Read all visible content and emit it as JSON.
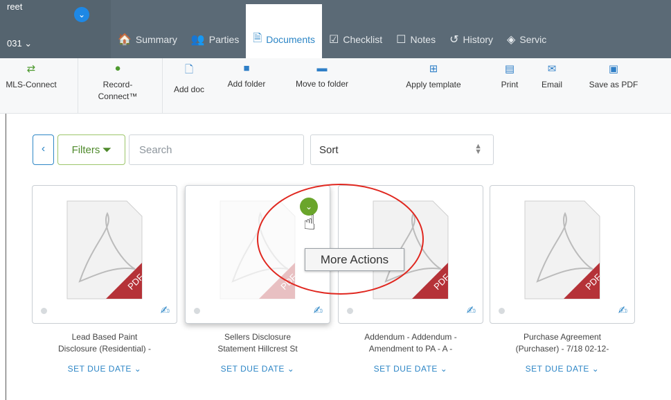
{
  "header": {
    "address_line1": "reet",
    "address_line2": "031 ⌄",
    "tabs": [
      {
        "label": "Summary",
        "icon": "home-icon"
      },
      {
        "label": "Parties",
        "icon": "people-icon"
      },
      {
        "label": "Documents",
        "icon": "document-icon"
      },
      {
        "label": "Checklist",
        "icon": "checklist-icon"
      },
      {
        "label": "Notes",
        "icon": "notes-icon"
      },
      {
        "label": "History",
        "icon": "history-icon"
      },
      {
        "label": "Servic",
        "icon": "services-icon"
      }
    ]
  },
  "toolbar": {
    "items": [
      {
        "label": "MLS-Connect",
        "icon": "mls-icon"
      },
      {
        "label": "Record-\nConnect™",
        "icon": "record-connect-icon"
      },
      {
        "label": "Add doc",
        "icon": "add-doc-icon"
      },
      {
        "label": "Add folder",
        "icon": "add-folder-icon"
      },
      {
        "label": "Move to folder",
        "icon": "move-folder-icon"
      },
      {
        "label": "Apply template",
        "icon": "template-icon"
      },
      {
        "label": "Print",
        "icon": "print-icon"
      },
      {
        "label": "Email",
        "icon": "email-icon"
      },
      {
        "label": "Save as PDF",
        "icon": "pdf-icon"
      }
    ]
  },
  "filters": {
    "back_label": "‹",
    "filters_label": "Filters",
    "search_placeholder": "Search",
    "sort_value": "Sort"
  },
  "documents": [
    {
      "title_line1": "Lead Based Paint",
      "title_line2": "Disclosure (Residential) -",
      "due_label": "SET DUE DATE ⌄"
    },
    {
      "title_line1": "Sellers Disclosure",
      "title_line2": "Statement Hillcrest St",
      "due_label": "SET DUE DATE ⌄"
    },
    {
      "title_line1": "Addendum - Addendum -",
      "title_line2": "Amendment to PA - A -",
      "due_label": "SET DUE DATE ⌄"
    },
    {
      "title_line1": "Purchase Agreement",
      "title_line2": "(Purchaser) - 7/18 02-12-",
      "due_label": "SET DUE DATE ⌄"
    }
  ],
  "tooltip": "More Actions",
  "pdf_badge": "PDF",
  "colors": {
    "accent": "#2d86c6",
    "nav": "#5b6a76",
    "annotation": "#e0271f",
    "more_button": "#6aa52b"
  }
}
